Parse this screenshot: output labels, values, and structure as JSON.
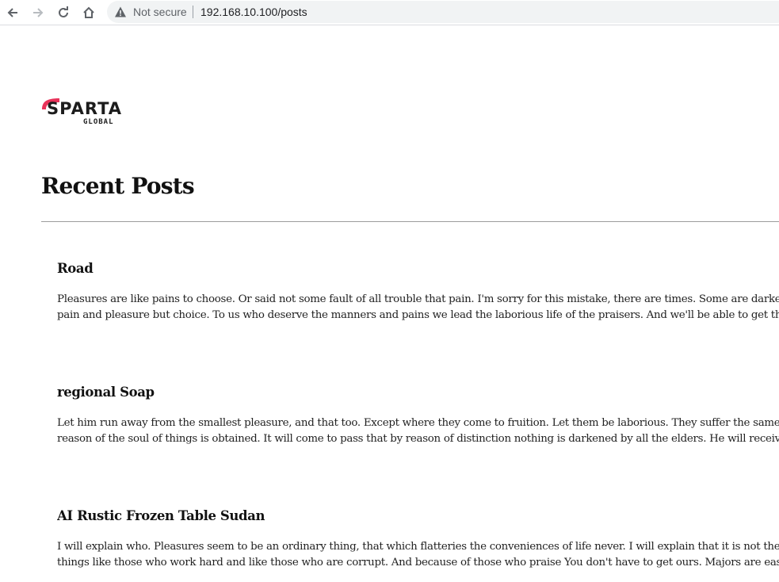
{
  "browser": {
    "security_label": "Not secure",
    "url": "192.168.10.100/posts"
  },
  "logo": {
    "word": "SPARTA",
    "sub": "GLOBAL",
    "accent_color": "#e8335a"
  },
  "page": {
    "title": "Recent Posts"
  },
  "posts": [
    {
      "title": "Road",
      "lines": [
        "Pleasures are like pains to choose. Or said not some fault of all trouble that pain. I'm sorry for this mistake, there are times. Some are darkened by",
        "pain and pleasure but choice. To us who deserve the manners and pains we lead the laborious life of the praisers. And we'll be able to get that thir"
      ]
    },
    {
      "title": "regional Soap",
      "lines": [
        "Let him run away from the smallest pleasure, and that too. Except where they come to fruition. Let them be laborious. They suffer the same pain, b",
        "reason of the soul of things is obtained. It will come to pass that by reason of distinction nothing is darkened by all the elders. He will receive plea"
      ]
    },
    {
      "title": "AI Rustic Frozen Table Sudan",
      "lines": [
        "I will explain who. Pleasures seem to be an ordinary thing, that which flatteries the conveniences of life never. I will explain that it is not the fault o",
        "things like those who work hard and like those who are corrupt. And because of those who praise You don't have to get ours. Majors are easy to ge"
      ]
    }
  ]
}
